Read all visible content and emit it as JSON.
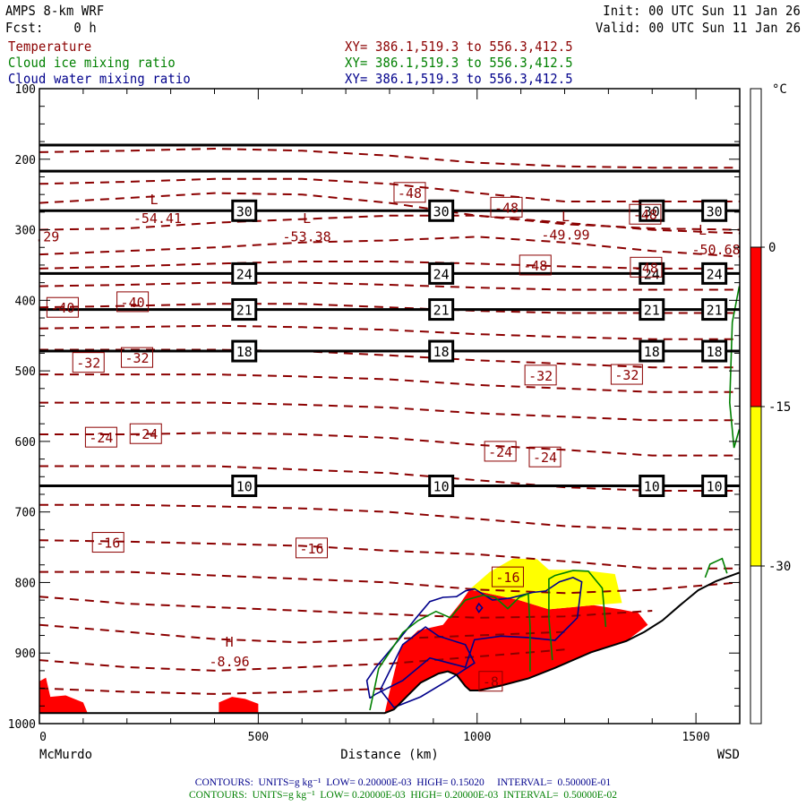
{
  "header": {
    "model": "AMPS 8-km WRF",
    "fcst": "Fcst:    0 h",
    "init": "Init: 00 UTC Sun 11 Jan 26",
    "valid": "Valid: 00 UTC Sun 11 Jan 26",
    "fields": [
      {
        "name": "Temperature",
        "xy": "XY= 386.1,519.3 to 556.3,412.5",
        "color": "#8b0000"
      },
      {
        "name": "Cloud ice mixing ratio",
        "xy": "XY= 386.1,519.3 to 556.3,412.5",
        "color": "#008000"
      },
      {
        "name": "Cloud water mixing ratio",
        "xy": "XY= 386.1,519.3 to 556.3,412.5",
        "color": "#00008b"
      }
    ]
  },
  "footer": {
    "water": "CONTOURS:  UNITS=g kg⁻¹  LOW= 0.20000E-03  HIGH= 0.15020     INTERVAL=  0.50000E-01",
    "ice": "CONTOURS:  UNITS=g kg⁻¹  LOW= 0.20000E-03  HIGH= 0.20000E-03  INTERVAL=  0.50000E-02"
  },
  "chart_data": {
    "type": "cross-section",
    "xlabel": "Distance (km)",
    "x_start_label": "McMurdo",
    "x_end_label": "WSD",
    "xlim": [
      0,
      1600
    ],
    "ylim": [
      100,
      1000
    ],
    "xticks": [
      0,
      500,
      1000,
      1500
    ],
    "yticks": [
      100,
      200,
      300,
      400,
      500,
      600,
      700,
      800,
      900,
      1000
    ],
    "colorbar": {
      "unit": "°C",
      "labels": [
        "0",
        "-15",
        "-30"
      ],
      "bands": [
        {
          "from": 0,
          "to": -15,
          "color": "#ff0000"
        },
        {
          "from": -15,
          "to": -30,
          "color": "#ffff00"
        }
      ]
    },
    "terrain": [
      [
        0,
        985
      ],
      [
        789,
        985
      ],
      [
        810,
        980
      ],
      [
        840,
        961
      ],
      [
        871,
        942
      ],
      [
        912,
        929
      ],
      [
        933,
        926
      ],
      [
        953,
        931
      ],
      [
        973,
        947
      ],
      [
        984,
        953
      ],
      [
        1004,
        953
      ],
      [
        1055,
        946
      ],
      [
        1117,
        936
      ],
      [
        1178,
        921
      ],
      [
        1260,
        899
      ],
      [
        1341,
        883
      ],
      [
        1382,
        870
      ],
      [
        1423,
        854
      ],
      [
        1464,
        832
      ],
      [
        1505,
        811
      ],
      [
        1546,
        798
      ],
      [
        1599,
        786
      ]
    ],
    "fill_red": [
      [
        [
          789,
          985
        ],
        [
          800,
          955
        ],
        [
          825,
          892
        ],
        [
          865,
          868
        ],
        [
          922,
          860
        ],
        [
          963,
          828
        ],
        [
          983,
          810
        ],
        [
          1096,
          825
        ],
        [
          1164,
          838
        ],
        [
          1266,
          832
        ],
        [
          1327,
          838
        ],
        [
          1368,
          843
        ],
        [
          1390,
          860
        ],
        [
          1341,
          883
        ],
        [
          1260,
          899
        ],
        [
          1178,
          921
        ],
        [
          1117,
          936
        ],
        [
          1055,
          946
        ],
        [
          1004,
          953
        ],
        [
          984,
          953
        ],
        [
          973,
          947
        ],
        [
          953,
          931
        ],
        [
          933,
          926
        ],
        [
          912,
          929
        ],
        [
          871,
          942
        ],
        [
          840,
          961
        ],
        [
          810,
          980
        ]
      ],
      [
        [
          0,
          940
        ],
        [
          15,
          935
        ],
        [
          25,
          962
        ],
        [
          60,
          960
        ],
        [
          100,
          970
        ],
        [
          110,
          985
        ],
        [
          0,
          985
        ]
      ],
      [
        [
          410,
          970
        ],
        [
          440,
          962
        ],
        [
          470,
          965
        ],
        [
          500,
          972
        ],
        [
          500,
          985
        ],
        [
          410,
          985
        ]
      ]
    ],
    "fill_yellow": [
      [
        [
          983,
          810
        ],
        [
          1029,
          785
        ],
        [
          1082,
          766
        ],
        [
          1137,
          767
        ],
        [
          1164,
          782
        ],
        [
          1233,
          782
        ],
        [
          1315,
          788
        ],
        [
          1331,
          829
        ],
        [
          1266,
          832
        ],
        [
          1164,
          838
        ],
        [
          1096,
          825
        ]
      ]
    ],
    "isolines": [
      {
        "p": 180,
        "labels": []
      },
      {
        "p": 217,
        "labels": []
      },
      {
        "p": 273,
        "label": "30",
        "label_km": [
          468,
          918,
          1399,
          1542
        ]
      },
      {
        "p": 362,
        "label": "24",
        "label_km": [
          468,
          918,
          1399,
          1542
        ]
      },
      {
        "p": 413,
        "label": "21",
        "label_km": [
          468,
          918,
          1399,
          1542
        ]
      },
      {
        "p": 472,
        "label": "18",
        "label_km": [
          468,
          918,
          1399,
          1542
        ]
      },
      {
        "p": 663,
        "label": "10",
        "label_km": [
          468,
          918,
          1399,
          1542
        ]
      }
    ],
    "temperature_contours": {
      "km": [
        0,
        200,
        400,
        600,
        800,
        1000,
        1200,
        1400,
        1600
      ],
      "lines": [
        [
          190,
          188,
          185,
          188,
          195,
          205,
          210,
          212,
          212
        ],
        [
          235,
          232,
          228,
          228,
          235,
          248,
          260,
          260,
          260
        ],
        [
          262,
          255,
          248,
          250,
          262,
          280,
          292,
          298,
          300
        ],
        [
          300,
          298,
          290,
          285,
          280,
          280,
          290,
          300,
          305
        ],
        [
          335,
          330,
          325,
          318,
          315,
          310,
          318,
          330,
          338
        ],
        [
          355,
          352,
          348,
          345,
          345,
          348,
          352,
          355,
          355
        ],
        [
          380,
          378,
          375,
          375,
          378,
          382,
          385,
          385,
          385
        ],
        [
          410,
          408,
          405,
          405,
          410,
          415,
          418,
          418,
          418
        ],
        [
          440,
          438,
          436,
          438,
          442,
          448,
          452,
          455,
          455
        ],
        [
          470,
          470,
          470,
          472,
          478,
          485,
          490,
          495,
          495
        ],
        [
          505,
          505,
          505,
          508,
          512,
          520,
          525,
          530,
          530
        ],
        [
          545,
          545,
          545,
          548,
          552,
          560,
          565,
          570,
          570
        ],
        [
          590,
          590,
          588,
          590,
          595,
          605,
          612,
          620,
          620
        ],
        [
          635,
          635,
          635,
          640,
          645,
          655,
          665,
          670,
          670
        ],
        [
          690,
          690,
          692,
          695,
          700,
          710,
          720,
          725,
          725
        ],
        [
          740,
          742,
          745,
          748,
          755,
          760,
          770,
          780,
          780
        ],
        [
          785,
          785,
          790,
          795,
          800,
          810,
          815,
          810,
          800
        ],
        [
          820,
          830,
          835,
          840,
          845,
          850,
          848,
          840,
          null
        ],
        [
          860,
          870,
          880,
          885,
          880,
          875,
          870,
          null,
          null
        ],
        [
          910,
          920,
          925,
          920,
          915,
          905,
          895,
          null,
          null
        ],
        [
          950,
          955,
          958,
          955,
          950,
          null,
          null,
          null,
          null
        ]
      ],
      "labels": [
        {
          "text": "-48",
          "km": 846,
          "p": 247
        },
        {
          "text": "-48",
          "km": 1067,
          "p": 268
        },
        {
          "text": "-48",
          "km": 1384,
          "p": 278
        },
        {
          "text": "-48",
          "km": 1133,
          "p": 350
        },
        {
          "text": "-48",
          "km": 1386,
          "p": 353
        },
        {
          "text": "-40",
          "km": 53,
          "p": 410
        },
        {
          "text": "-40",
          "km": 213,
          "p": 402
        },
        {
          "text": "-32",
          "km": 112,
          "p": 488
        },
        {
          "text": "-32",
          "km": 223,
          "p": 481
        },
        {
          "text": "-32",
          "km": 1145,
          "p": 506
        },
        {
          "text": "-32",
          "km": 1342,
          "p": 505
        },
        {
          "text": "-24",
          "km": 141,
          "p": 594
        },
        {
          "text": "-24",
          "km": 243,
          "p": 589
        },
        {
          "text": "-24",
          "km": 1053,
          "p": 614
        },
        {
          "text": "-24",
          "km": 1155,
          "p": 622
        },
        {
          "text": "-16",
          "km": 157,
          "p": 743
        },
        {
          "text": "-16",
          "km": 622,
          "p": 751
        },
        {
          "text": "-16",
          "km": 1070,
          "p": 792
        },
        {
          "text": "-8",
          "km": 1031,
          "p": 940
        }
      ],
      "extrema": [
        {
          "type": "L",
          "value": "-54.41",
          "km": 262,
          "p": 256,
          "vkm": 270,
          "vp": 283
        },
        {
          "type": "L",
          "value": "-53.38",
          "km": 611,
          "p": 283,
          "vkm": 611,
          "vp": 309
        },
        {
          "type": "L",
          "value": "-49.99",
          "km": 1202,
          "p": 280,
          "vkm": 1202,
          "vp": 306
        },
        {
          "type": "L",
          "value": "-50.68",
          "km": 1515,
          "p": 299,
          "vkm": 1546,
          "vp": 327
        },
        {
          "type": "H",
          "value": "-8.96",
          "km": 434,
          "p": 883,
          "vkm": 434,
          "vp": 911
        },
        {
          "type": "",
          "value": ".29",
          "km": 0,
          "p": 283,
          "vkm": 18,
          "vp": 309
        }
      ]
    },
    "cloud_ice_contours": [
      [
        [
          755,
          981
        ],
        [
          775,
          922
        ],
        [
          830,
          871
        ],
        [
          865,
          854
        ],
        [
          906,
          841
        ],
        [
          939,
          850
        ],
        [
          973,
          825
        ],
        [
          1014,
          818
        ],
        [
          1041,
          821
        ],
        [
          1070,
          837
        ],
        [
          1096,
          821
        ],
        [
          1117,
          816
        ],
        [
          1121,
          863
        ],
        [
          1121,
          926
        ]
      ],
      [
        [
          1172,
          910
        ],
        [
          1164,
          850
        ],
        [
          1164,
          795
        ],
        [
          1178,
          790
        ],
        [
          1219,
          783
        ],
        [
          1254,
          784
        ],
        [
          1286,
          808
        ],
        [
          1294,
          863
        ]
      ],
      [
        [
          1521,
          793
        ],
        [
          1532,
          774
        ],
        [
          1560,
          766
        ],
        [
          1571,
          787
        ]
      ],
      [
        [
          1599,
          380
        ],
        [
          1583,
          431
        ],
        [
          1577,
          545
        ],
        [
          1587,
          609
        ],
        [
          1599,
          583
        ]
      ]
    ],
    "cloud_water_contours": [
      [
        [
          755,
          964
        ],
        [
          748,
          939
        ],
        [
          769,
          920
        ],
        [
          820,
          882
        ],
        [
          861,
          850
        ],
        [
          892,
          827
        ],
        [
          922,
          821
        ],
        [
          953,
          820
        ],
        [
          973,
          812
        ],
        [
          994,
          809
        ],
        [
          1035,
          825
        ],
        [
          1076,
          822
        ],
        [
          1127,
          814
        ],
        [
          1157,
          812
        ],
        [
          1188,
          799
        ],
        [
          1219,
          793
        ],
        [
          1239,
          799
        ],
        [
          1229,
          850
        ],
        [
          1178,
          882
        ],
        [
          1117,
          878
        ],
        [
          1055,
          876
        ],
        [
          994,
          881
        ],
        [
          973,
          920
        ],
        [
          892,
          907
        ],
        [
          830,
          939
        ],
        [
          769,
          958
        ],
        [
          755,
          964
        ]
      ],
      [
        [
          779,
          952
        ],
        [
          830,
          888
        ],
        [
          882,
          863
        ],
        [
          912,
          876
        ],
        [
          973,
          888
        ],
        [
          994,
          914
        ],
        [
          933,
          939
        ],
        [
          871,
          962
        ],
        [
          810,
          977
        ],
        [
          779,
          952
        ]
      ],
      [
        [
          998,
          836
        ],
        [
          1004,
          830
        ],
        [
          1012,
          836
        ],
        [
          1004,
          842
        ],
        [
          998,
          836
        ]
      ]
    ]
  }
}
